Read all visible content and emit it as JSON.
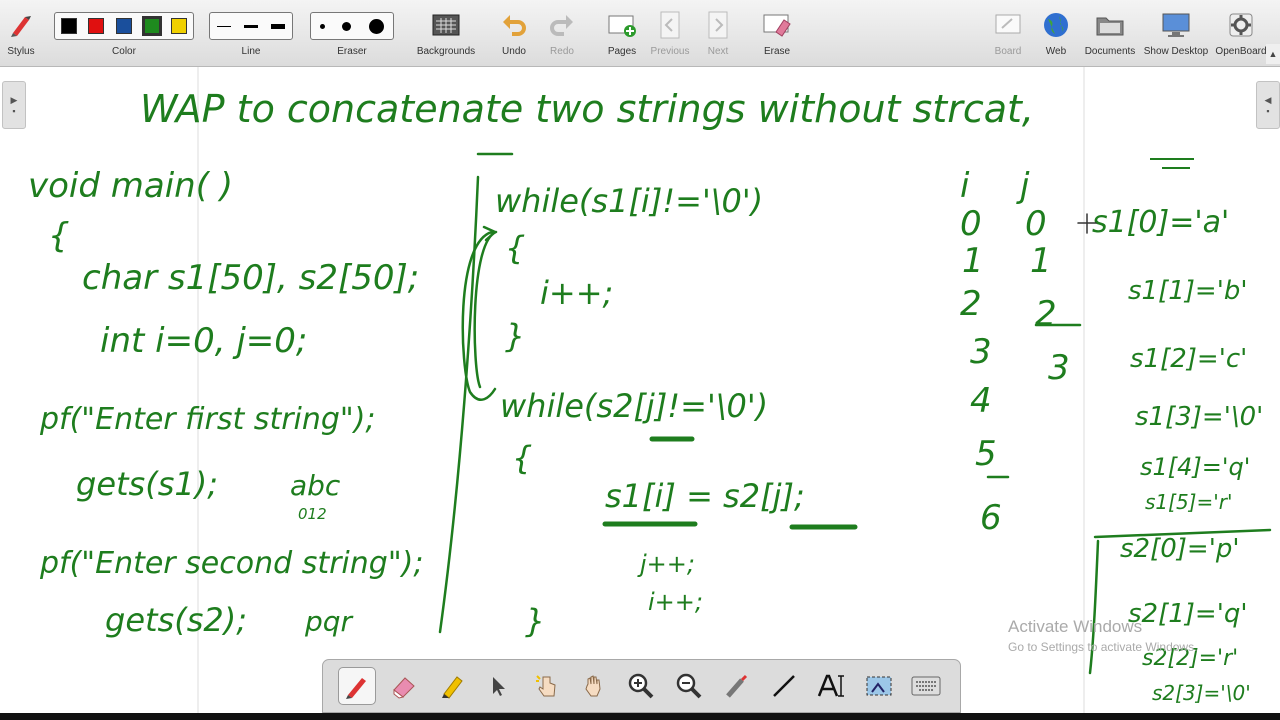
{
  "toolbar": {
    "stylus_label": "Stylus",
    "color_label": "Color",
    "line_label": "Line",
    "eraser_label": "Eraser",
    "backgrounds_label": "Backgrounds",
    "undo_label": "Undo",
    "redo_label": "Redo",
    "pages_label": "Pages",
    "previous_label": "Previous",
    "next_label": "Next",
    "erase_label": "Erase",
    "board_label": "Board",
    "web_label": "Web",
    "documents_label": "Documents",
    "show_desktop_label": "Show Desktop",
    "openboard_label": "OpenBoard",
    "colors": [
      "#000000",
      "#e01010",
      "#1a4f9c",
      "#1e8a1e",
      "#f0d000"
    ]
  },
  "board": {
    "ink_color": "#1e7d1e",
    "title": "WAP to concatenate two strings without strcat,",
    "left_code": [
      "void main( )",
      "{",
      "char s1[50], s2[50];",
      "int i=0, j=0;",
      "pf(\"Enter first string\");",
      "gets(s1);",
      "abc",
      "012",
      "pf(\"Enter second string\");",
      "gets(s2);",
      "pqr"
    ],
    "middle_code": [
      "while(s1[i]!='\\0')",
      "{",
      "i++;",
      "}",
      "while(s2[j]!='\\0')",
      "{",
      "s1[i] = s2[j];",
      "j++;",
      "i++;",
      "}"
    ],
    "i_values": [
      "i",
      "0",
      "1",
      "2",
      "3",
      "4",
      "5",
      "6"
    ],
    "j_values": [
      "j",
      "0",
      "1",
      "2",
      "3"
    ],
    "right_notes": [
      "s1[0]='a'",
      "s1[1]='b'",
      "s1[2]='c'",
      "s1[3]='\\0'",
      "s1[4]='q'",
      "s1[5]='r'",
      "s2[0]='p'",
      "s2[1]='q'",
      "s2[2]='r'",
      "s2[3]='\\0'"
    ]
  },
  "watermark": {
    "line1": "Activate Windows",
    "line2": "Go to Settings to activate Windows."
  },
  "palette": {
    "tools": [
      "pen-tool-icon",
      "eraser-tool-icon",
      "marker-tool-icon",
      "selector-tool-icon",
      "interact-tool-icon",
      "hand-tool-icon",
      "zoom-in-icon",
      "zoom-out-icon",
      "laser-pointer-icon",
      "line-tool-icon",
      "text-tool-icon",
      "capture-tool-icon",
      "keyboard-icon"
    ]
  }
}
